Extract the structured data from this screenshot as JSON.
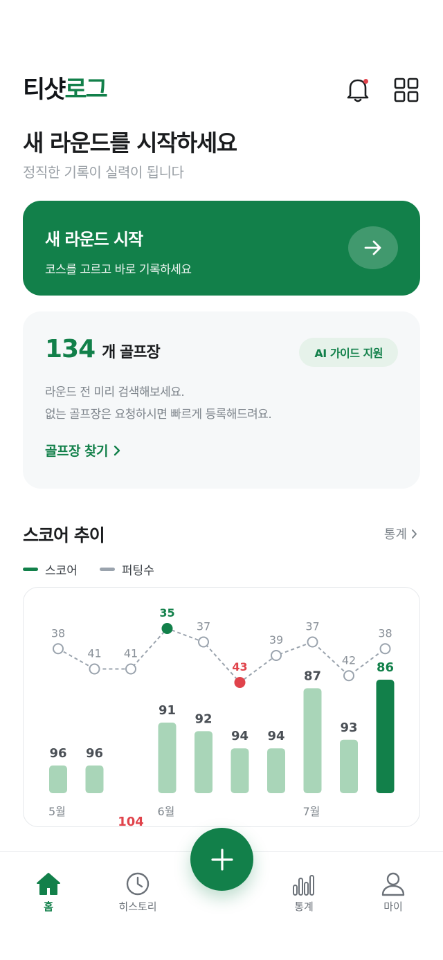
{
  "app": {
    "logo_part1": "티샷",
    "logo_part2": "로그"
  },
  "header": {
    "bell_icon": "bell-icon",
    "menu_icon": "grid-icon",
    "notification_dot_color": "#e0434b"
  },
  "hero": {
    "title": "새 라운드를 시작하세요",
    "subtitle": "정직한 기록이 실력이 됩니다"
  },
  "start_card": {
    "title": "새 라운드 시작",
    "subtitle": "코스를 고르고 바로 기록하세요",
    "icon": "arrow-right-icon"
  },
  "course_card": {
    "count": "134",
    "unit": "개 골프장",
    "badge": "AI 가이드 지원",
    "desc_line1": "라운드 전 미리 검색해보세요.",
    "desc_line2": "없는 골프장은 요청하시면 빠르게 등록해드려요.",
    "link": "골프장 찾기"
  },
  "score_section": {
    "title": "스코어 추이",
    "stats_link": "통계",
    "legend": [
      {
        "label": "스코어",
        "color": "#12804a"
      },
      {
        "label": "퍼팅수",
        "color": "#9aa3ad"
      }
    ]
  },
  "chart_data": {
    "type": "bar",
    "x_month_labels": [
      {
        "index": 0,
        "label": "5월"
      },
      {
        "index": 3,
        "label": "6월"
      },
      {
        "index": 7,
        "label": "7월"
      }
    ],
    "series": [
      {
        "name": "스코어",
        "type": "bar",
        "values": [
          96,
          96,
          104,
          91,
          92,
          94,
          94,
          87,
          93,
          86
        ]
      },
      {
        "name": "퍼팅수",
        "type": "line",
        "values": [
          38,
          41,
          41,
          35,
          37,
          43,
          39,
          37,
          42,
          38
        ]
      }
    ],
    "highlight": {
      "best_score_index": 7,
      "worst_score_index": 2,
      "latest_index": 9,
      "best_putt_index": 3,
      "worst_putt_index": 5
    },
    "colors": {
      "bar": "#a9d5b8",
      "bar_latest": "#12804a",
      "bar_worst": "#e0434b",
      "putt": "#9aa3ad",
      "best": "#12804a",
      "worst": "#e0434b"
    }
  },
  "bottom_nav": {
    "items": [
      {
        "label": "홈",
        "icon": "home-icon"
      },
      {
        "label": "히스토리",
        "icon": "clock-icon"
      },
      {
        "label": "통계",
        "icon": "bar-chart-icon"
      },
      {
        "label": "마이",
        "icon": "user-icon"
      }
    ],
    "fab_icon": "plus-icon"
  }
}
